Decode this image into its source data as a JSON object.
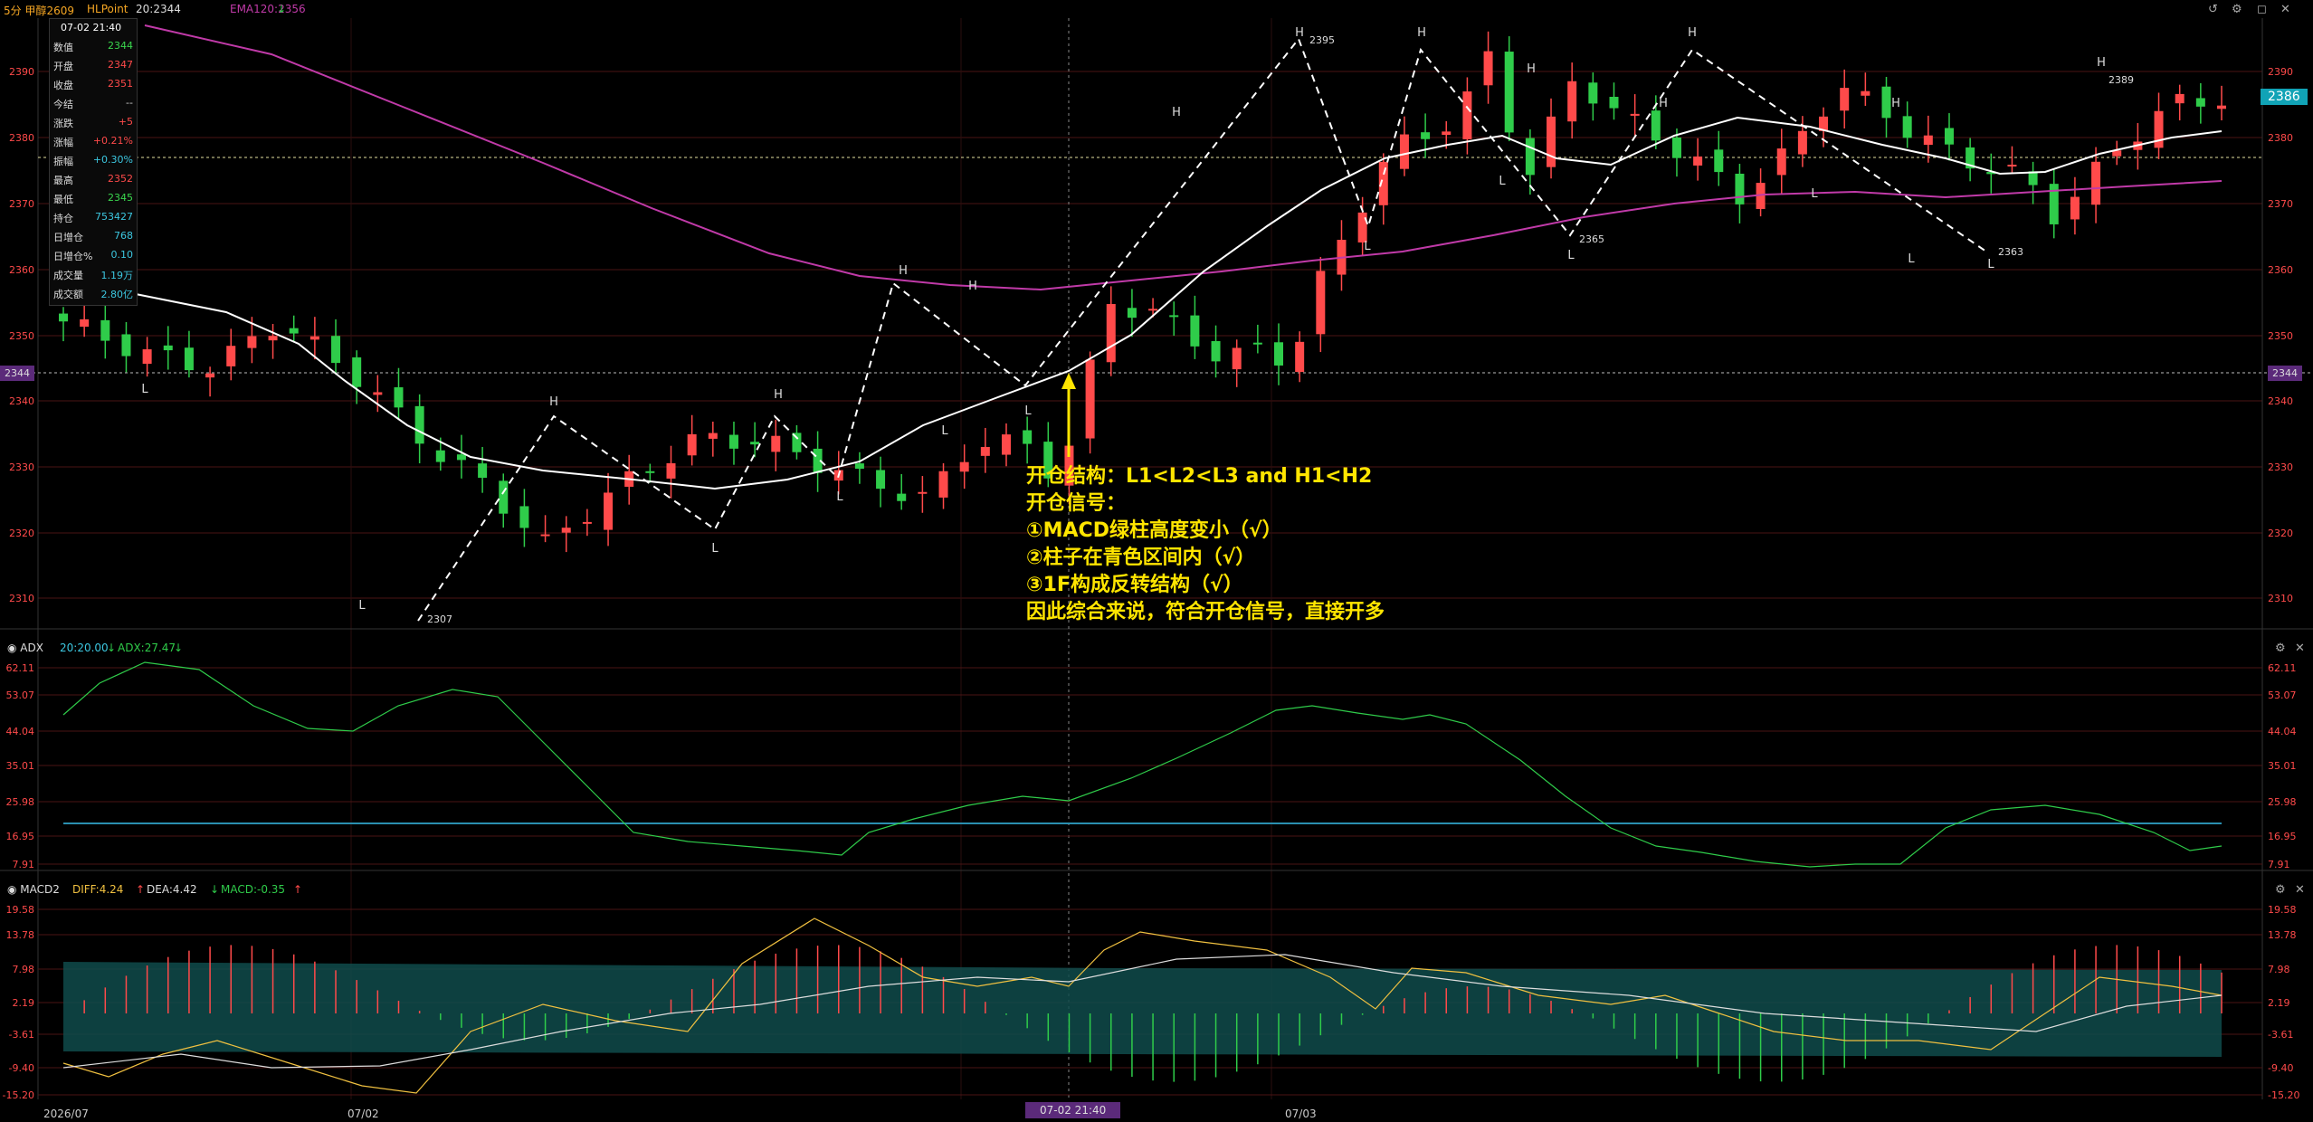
{
  "topbar": {
    "title": "5分 甲醇2609",
    "source": "HLPoint",
    "ema20": "20:2344",
    "ema120": "EMA120:2356"
  },
  "info": {
    "datetime": "07-02 21:40",
    "rows": [
      {
        "k": "数值",
        "v": "2344",
        "c": "#3ad64e"
      },
      {
        "k": "开盘",
        "v": "2347",
        "c": "#ff4a4a"
      },
      {
        "k": "收盘",
        "v": "2351",
        "c": "#ff4a4a"
      },
      {
        "k": "今结",
        "v": "--",
        "c": "#cccccc"
      },
      {
        "k": "涨跌",
        "v": "+5",
        "c": "#ff4a4a"
      },
      {
        "k": "涨幅",
        "v": "+0.21%",
        "c": "#ff4a4a"
      },
      {
        "k": "振幅",
        "v": "+0.30%",
        "c": "#3cc7e0"
      },
      {
        "k": "最高",
        "v": "2352",
        "c": "#ff4a4a"
      },
      {
        "k": "最低",
        "v": "2345",
        "c": "#3ad64e"
      },
      {
        "k": "持仓",
        "v": "753427",
        "c": "#3cc7e0"
      },
      {
        "k": "日增仓",
        "v": "768",
        "c": "#3cc7e0"
      },
      {
        "k": "日增仓%",
        "v": "0.10",
        "c": "#3cc7e0"
      },
      {
        "k": "成交量",
        "v": "1.19万",
        "c": "#3cc7e0"
      },
      {
        "k": "成交额",
        "v": "2.80亿",
        "c": "#3cc7e0"
      }
    ]
  },
  "price_axis": {
    "ticks": [
      "2390",
      "2380",
      "2370",
      "2360",
      "2350",
      "2340",
      "2330",
      "2320",
      "2310"
    ],
    "current": "2386",
    "cursor": "2344"
  },
  "annotation": {
    "lines": [
      "开仓结构：L1<L2<L3 and H1<H2",
      "开仓信号：",
      "①MACD绿柱高度变小（√）",
      "②柱子在青色区间内（√）",
      "③1F构成反转结构（√）",
      "因此综合来说，符合开仓信号，直接开多"
    ]
  },
  "structure_labels": {
    "p2307": "2307",
    "p2395": "2395",
    "p2365": "2365",
    "p2363": "2363",
    "p2389": "2389",
    "H": "H",
    "L": "L"
  },
  "adx": {
    "name": "ADX",
    "values": "20:20.00",
    "adx": "ADX:27.47",
    "ticks": [
      "62.11",
      "53.07",
      "44.04",
      "35.01",
      "25.98",
      "16.95",
      "7.91"
    ]
  },
  "macd": {
    "name": "MACD2",
    "diff": "DIFF:4.24",
    "dea": "DEA:4.42",
    "macd": "MACD:-0.35",
    "ticks": [
      "19.58",
      "13.78",
      "7.98",
      "2.19",
      "-3.61",
      "-9.40",
      "-15.20"
    ]
  },
  "time_axis": {
    "labels": [
      "2026/07",
      "07/02",
      "07/03"
    ],
    "cursor": "07-02 21:40"
  },
  "colors": {
    "up": "#ff4a4a",
    "down": "#2fcc4a",
    "ema120": "#c03aa8",
    "ema20": "#ffffff",
    "annotation": "#ffe500",
    "teal_band": "#0f4b4b"
  },
  "icons": [
    "undo-icon",
    "settings-icon",
    "fullscreen-icon",
    "close-icon"
  ]
}
